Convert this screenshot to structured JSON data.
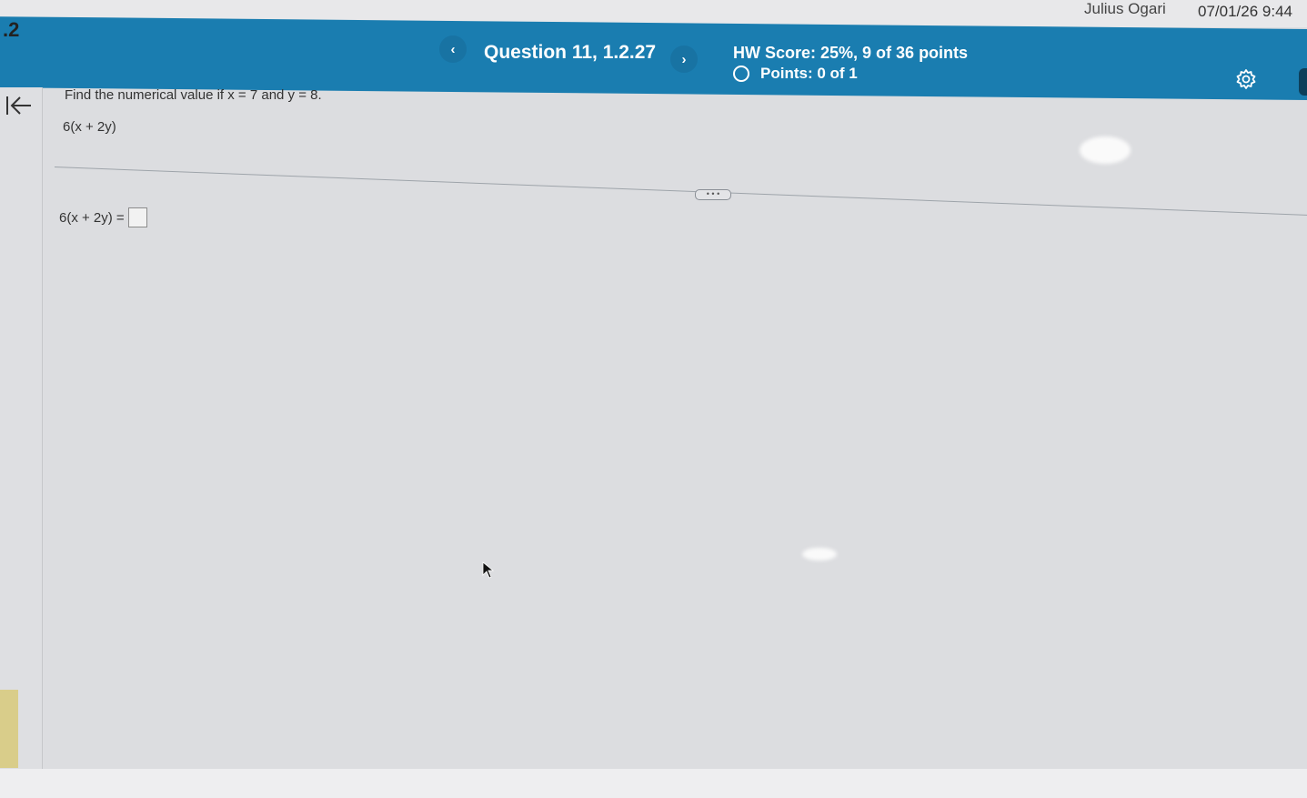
{
  "status_bar": {
    "user_name": "Julius Ogari",
    "timestamp": "07/01/26 9:44"
  },
  "section_number": ".2",
  "header": {
    "prev_label": "‹",
    "question_label": "Question 11, 1.2.27",
    "next_label": "›",
    "hw_score": "HW Score: 25%, 9 of 36 points",
    "points": "Points: 0 of 1",
    "settings_icon": "gear-icon"
  },
  "sidebar": {
    "collapse_icon": "collapse-left-icon"
  },
  "question": {
    "instructions": "Find the numerical value if x = 7 and y = 8.",
    "expression": "6(x + 2y)",
    "more_label": "• • •",
    "answer_prefix": "6(x + 2y) ="
  },
  "colors": {
    "header_blue": "#1a7db0",
    "background": "#dcdde0"
  }
}
